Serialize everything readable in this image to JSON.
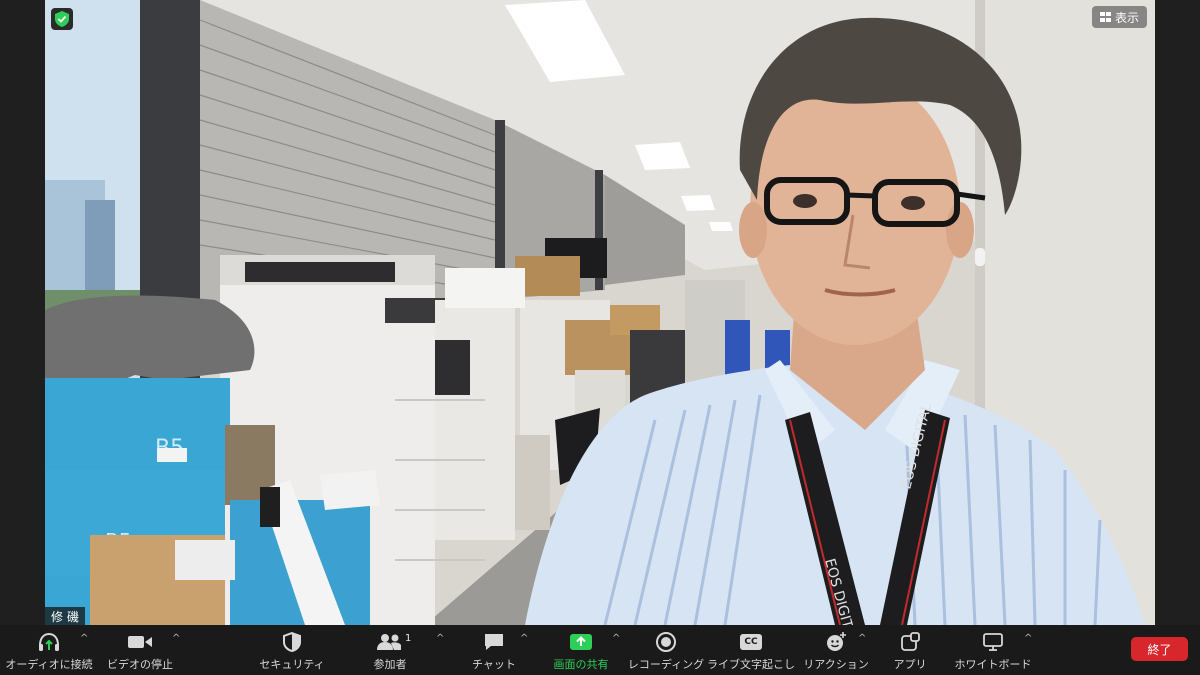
{
  "meeting": {
    "view_label": "表示",
    "participant_name": "修 磯"
  },
  "toolbar": {
    "audio_label": "オーディオに接続",
    "video_label": "ビデオの停止",
    "security_label": "セキュリティ",
    "participants_label": "参加者",
    "participants_count": "1",
    "chat_label": "チャット",
    "share_label": "画面の共有",
    "record_label": "レコーディング",
    "captions_label": "ライブ文字起こし",
    "captions_icon_text": "CC",
    "reactions_label": "リアクション",
    "apps_label": "アプリ",
    "whiteboard_label": "ホワイトボード",
    "end_label": "終了"
  },
  "colors": {
    "toolbar_bg": "#1a1a1a",
    "share_green": "#2ecf58",
    "end_red": "#d8262d"
  }
}
